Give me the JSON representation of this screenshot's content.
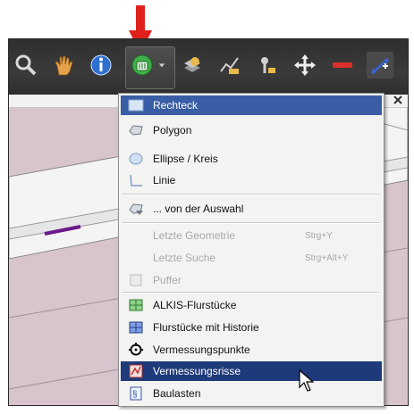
{
  "colors": {
    "annotation_arrow": "#e0201b",
    "menu_selected_bg": "#3a5ea6",
    "menu_hover_bg": "#1f3a7a",
    "menu_bg": "#f3f3f1",
    "toolbar_bg": "#333333",
    "map_bg": "#d7c4cd"
  },
  "toolbar": {
    "icons": [
      "magnifier-icon",
      "pan-hand-icon",
      "info-icon",
      "select-by-shape-icon",
      "layer-query-icon",
      "chart-icon",
      "measure-point-icon",
      "move-icon",
      "remove-icon",
      "draw-line-icon"
    ]
  },
  "menu": {
    "items": [
      {
        "label": "Rechteck",
        "icon": "rectangle-icon",
        "state": "selected"
      },
      {
        "label": "Polygon",
        "icon": "polygon-icon",
        "state": "normal"
      },
      {
        "label": "Ellipse / Kreis",
        "icon": "ellipse-icon",
        "state": "normal"
      },
      {
        "label": "Linie",
        "icon": "line-icon",
        "state": "normal"
      },
      {
        "label": "... von der Auswahl",
        "icon": "from-selection-icon",
        "state": "normal"
      },
      {
        "label": "Letzte Geometrie",
        "shortcut": "Strg+Y",
        "state": "disabled"
      },
      {
        "label": "Letzte Suche",
        "shortcut": "Strg+Alt+Y",
        "state": "disabled"
      },
      {
        "label": "Puffer",
        "icon": "buffer-icon",
        "state": "disabled"
      },
      {
        "label": "ALKIS-Flurstücke",
        "icon": "parcel-icon",
        "state": "normal"
      },
      {
        "label": "Flurstücke mit Historie",
        "icon": "parcel-history-icon",
        "state": "normal"
      },
      {
        "label": "Vermessungspunkte",
        "icon": "survey-point-icon",
        "state": "normal"
      },
      {
        "label": "Vermessungsrisse",
        "icon": "survey-sketch-icon",
        "state": "hover"
      },
      {
        "label": "Baulasten",
        "icon": "building-encumbrance-icon",
        "state": "normal"
      }
    ]
  }
}
